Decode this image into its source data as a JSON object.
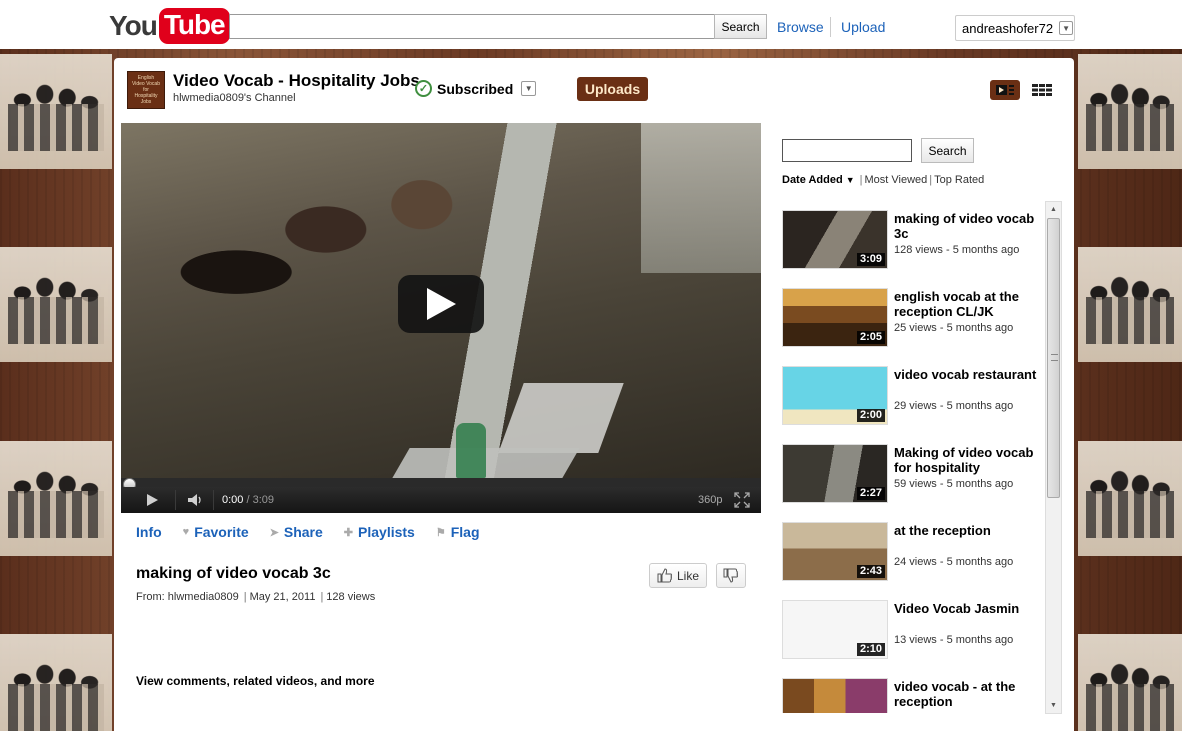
{
  "masthead": {
    "logo_you": "You",
    "logo_tube": "Tube",
    "search_button": "Search",
    "search_value": "",
    "links": [
      "Browse",
      "Upload"
    ],
    "username": "andreashofer72"
  },
  "channel": {
    "thumb_text": "English Video Vocab for Hospitality Jobs",
    "title": "Video Vocab - Hospitality Jobs",
    "subtitle": "hlwmedia0809's Channel",
    "subscribed_label": "Subscribed",
    "uploads_label": "Uploads"
  },
  "player": {
    "current_time": "0:00",
    "duration": "3:09",
    "time_sep": " / ",
    "quality": "360p",
    "progress": 0
  },
  "actions": [
    {
      "label": "Info",
      "icon": "none"
    },
    {
      "label": "Favorite",
      "icon": "heart-icon"
    },
    {
      "label": "Share",
      "icon": "arrow-icon"
    },
    {
      "label": "Playlists",
      "icon": "plus-icon"
    },
    {
      "label": "Flag",
      "icon": "flag-icon"
    }
  ],
  "video": {
    "title": "making of video vocab 3c",
    "from_label": "From:",
    "author": "hlwmedia0809",
    "date": "May 21, 2011",
    "views": "128 views",
    "like_label": "Like",
    "view_more": "View comments, related videos, and more"
  },
  "sidebar": {
    "search_button": "Search",
    "search_value": "",
    "sort": {
      "active": "Date Added",
      "options": [
        "Most Viewed",
        "Top Rated"
      ]
    },
    "videos": [
      {
        "title": "making of video vocab 3c",
        "meta": "128 views - 5 months ago",
        "duration": "3:09"
      },
      {
        "title": "english vocab at the reception CL/JK",
        "meta": "25 views - 5 months ago",
        "duration": "2:05"
      },
      {
        "title": "video vocab restaurant",
        "meta": "29 views - 5 months ago",
        "duration": "2:00"
      },
      {
        "title": "Making of video vocab for hospitality",
        "meta": "59 views - 5 months ago",
        "duration": "2:27"
      },
      {
        "title": "at the reception",
        "meta": "24 views - 5 months ago",
        "duration": "2:43"
      },
      {
        "title": "Video Vocab  Jasmin",
        "meta": "13 views - 5 months ago",
        "duration": "2:10"
      },
      {
        "title": "video vocab - at the reception",
        "meta": "",
        "duration": ""
      }
    ]
  },
  "colors": {
    "link": "#1c62b9",
    "brand_red": "#e0001b",
    "channel_brown": "#6a2f14",
    "uploads_text": "#fde8c8"
  }
}
